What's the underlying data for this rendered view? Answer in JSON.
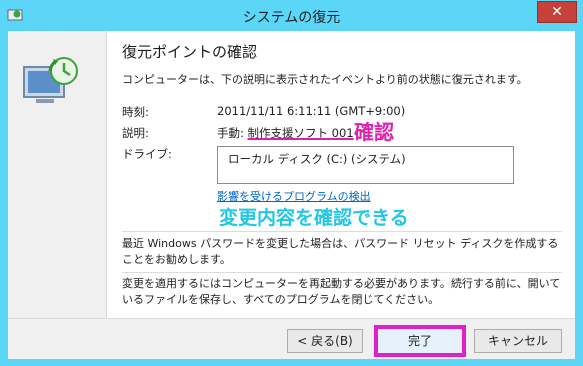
{
  "window": {
    "title": "システムの復元"
  },
  "heading": "復元ポイントの確認",
  "intro": "コンピューターは、下の説明に表示されたイベントより前の状態に復元されます。",
  "fields": {
    "time_label": "時刻:",
    "time_value": "2011/11/11 6:11:11 (GMT+9:00)",
    "desc_label": "説明:",
    "desc_prefix": "手動:",
    "desc_value": "制作支援ソフト 001",
    "drive_label": "ドライブ:",
    "drive_items": [
      "ローカル ディスク (C:) (システム)"
    ]
  },
  "link": "影響を受けるプログラムの検出",
  "annotations": {
    "confirm": "確認",
    "changes": "変更内容を確認できる"
  },
  "paragraph1": "最近 Windows パスワードを変更した場合は、パスワード リセット ディスクを作成することをお勧めします。",
  "paragraph2": "変更を適用するにはコンピューターを再起動する必要があります。続行する前に、開いているファイルを保存し、すべてのプログラムを閉じてください。",
  "buttons": {
    "back": "< 戻る(B)",
    "finish": "完了",
    "cancel": "キャンセル"
  },
  "colors": {
    "frame": "#5bd6f6",
    "annotation_pink": "#e020b0",
    "annotation_cyan": "#22c7e8",
    "link": "#0066cc"
  }
}
